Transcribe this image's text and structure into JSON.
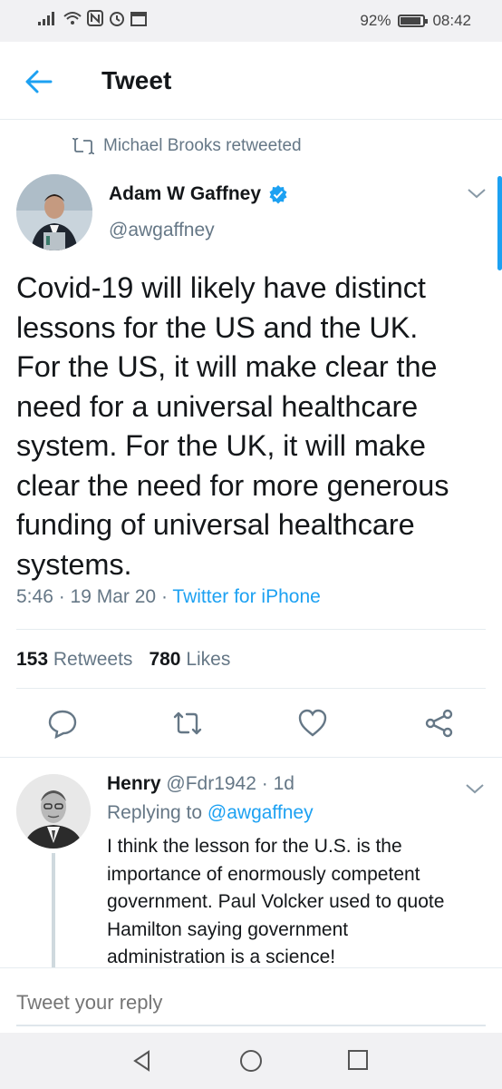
{
  "status_bar": {
    "battery": "92%",
    "battery_level": 0.92,
    "time": "08:42"
  },
  "header": {
    "title": "Tweet",
    "back_icon": "arrow-left-icon"
  },
  "retweet": {
    "text": "Michael Brooks retweeted",
    "icon": "retweet-icon"
  },
  "tweet": {
    "author_name": "Adam W Gaffney",
    "handle": "@awgaffney",
    "verified": true,
    "text": "Covid-19 will likely have distinct\nlessons for the US and the UK.\nFor the US, it will make clear the\nneed for a universal healthcare\nsystem.  For the UK, it will make\nclear the need for more generous\nfunding of universal healthcare\nsystems.",
    "time": "5:46",
    "date": "19 Mar 20",
    "source": "Twitter for iPhone",
    "retweets_count": "153",
    "retweets_label": "Retweets",
    "likes_count": "780",
    "likes_label": "Likes"
  },
  "reply": {
    "name": "Henry",
    "handle": "@Fdr1942",
    "age": "1d",
    "replying_to_label": "Replying to",
    "replying_to": "@awgaffney",
    "text": "I think the lesson for the U.S. is the\nimportance of enormously competent\ngovernment. Paul Volcker used to quote\nHamilton saying government\nadministration is a science!"
  },
  "compose": {
    "placeholder": "Tweet your reply"
  },
  "colors": {
    "accent": "#1da1f2",
    "secondary_text": "#657786",
    "primary_text": "#14171a"
  }
}
